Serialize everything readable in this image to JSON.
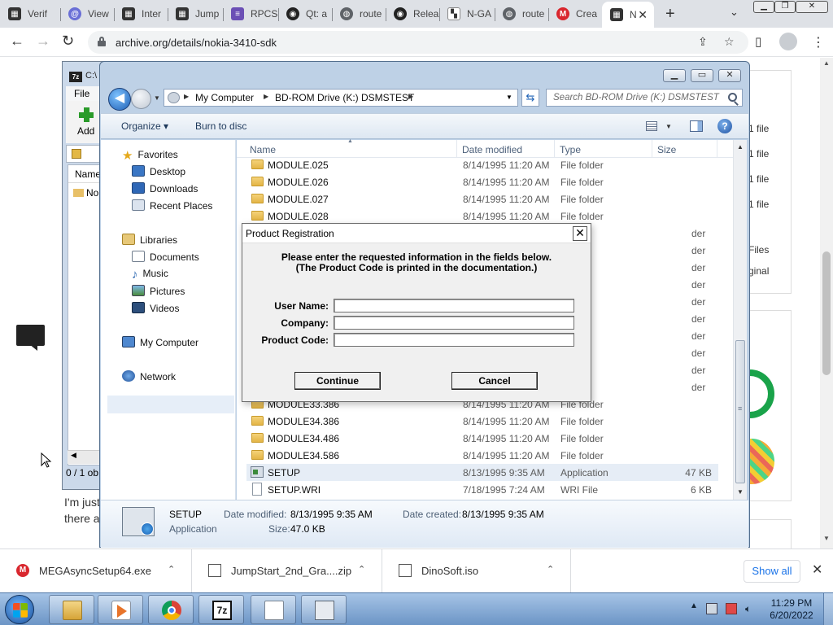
{
  "browser": {
    "tabs": [
      {
        "label": "Verif",
        "icon": "tab-page-icon"
      },
      {
        "label": "View",
        "icon": "tab-at-icon"
      },
      {
        "label": "Inter",
        "icon": "tab-page-icon"
      },
      {
        "label": "Jump",
        "icon": "tab-page-icon"
      },
      {
        "label": "RPCS",
        "icon": "tab-rpcs-icon"
      },
      {
        "label": "Qt: a",
        "icon": "github-icon"
      },
      {
        "label": "route",
        "icon": "globe-icon"
      },
      {
        "label": "Relea",
        "icon": "github-icon"
      },
      {
        "label": "N-GA",
        "icon": "grid-icon"
      },
      {
        "label": "route",
        "icon": "globe-icon"
      },
      {
        "label": "Crea",
        "icon": "mega-icon"
      },
      {
        "label": "N",
        "icon": "tab-page-icon"
      }
    ],
    "url": "archive.org/details/nokia-3410-sdk"
  },
  "page": {
    "side_panel_lines": [
      "1 file",
      "1 file",
      "1 file",
      "1 file",
      "Files",
      "ginal"
    ],
    "text_lines": [
      "I'm just",
      "there a"
    ]
  },
  "sevenzip": {
    "title": "C:\\",
    "menu_file": "File",
    "add_label": "Add",
    "col_name": "Name",
    "row": "No",
    "status": "0 / 1 ob"
  },
  "explorer": {
    "breadcrumb": [
      "My Computer",
      "BD-ROM Drive (K:) DSMSTEST"
    ],
    "search_placeholder": "Search BD-ROM Drive (K:) DSMSTEST",
    "commands": {
      "organize": "Organize",
      "burn": "Burn to disc"
    },
    "nav": {
      "favorites": "Favorites",
      "favorites_items": [
        "Desktop",
        "Downloads",
        "Recent Places"
      ],
      "libraries": "Libraries",
      "libraries_items": [
        "Documents",
        "Music",
        "Pictures",
        "Videos"
      ],
      "computer": "My Computer",
      "network": "Network"
    },
    "columns": {
      "name": "Name",
      "date": "Date modified",
      "type": "Type",
      "size": "Size"
    },
    "files_top": [
      {
        "name": "MODULE.025",
        "date": "8/14/1995 11:20 AM",
        "type": "File folder",
        "size": ""
      },
      {
        "name": "MODULE.026",
        "date": "8/14/1995 11:20 AM",
        "type": "File folder",
        "size": ""
      },
      {
        "name": "MODULE.027",
        "date": "8/14/1995 11:20 AM",
        "type": "File folder",
        "size": ""
      },
      {
        "name": "MODULE.028",
        "date": "8/14/1995 11:20 AM",
        "type": "File folder",
        "size": ""
      }
    ],
    "hidden_rows_text": [
      "der",
      "der",
      "der",
      "der",
      "der",
      "der",
      "der",
      "der",
      "der",
      "der"
    ],
    "files_bottom": [
      {
        "name": "MODULE33.386",
        "date": "8/14/1995 11:20 AM",
        "type": "File folder",
        "size": ""
      },
      {
        "name": "MODULE34.386",
        "date": "8/14/1995 11:20 AM",
        "type": "File folder",
        "size": ""
      },
      {
        "name": "MODULE34.486",
        "date": "8/14/1995 11:20 AM",
        "type": "File folder",
        "size": ""
      },
      {
        "name": "MODULE34.586",
        "date": "8/14/1995 11:20 AM",
        "type": "File folder",
        "size": ""
      },
      {
        "name": "SETUP",
        "date": "8/13/1995 9:35 AM",
        "type": "Application",
        "size": "47 KB"
      },
      {
        "name": "SETUP.WRI",
        "date": "7/18/1995 7:24 AM",
        "type": "WRI File",
        "size": "6 KB"
      }
    ],
    "details": {
      "name": "SETUP",
      "kind": "Application",
      "modified_label": "Date modified:",
      "modified": "8/13/1995 9:35 AM",
      "created_label": "Date created:",
      "created": "8/13/1995 9:35 AM",
      "size_label": "Size:",
      "size": "47.0 KB"
    }
  },
  "dialog": {
    "title": "Product Registration",
    "line1": "Please enter the requested information in the fields below.",
    "line2": "(The Product Code is printed in the documentation.)",
    "user_label": "User Name:",
    "company_label": "Company:",
    "code_label": "Product Code:",
    "user_value": "",
    "company_value": "",
    "code_value": "",
    "continue_label": "Continue",
    "cancel_label": "Cancel"
  },
  "downloads": {
    "items": [
      "MEGAsyncSetup64.exe",
      "JumpStart_2nd_Gra....zip",
      "DinoSoft.iso"
    ],
    "show_all": "Show all"
  },
  "taskbar": {
    "time": "11:29 PM",
    "date": "6/20/2022"
  },
  "colors": {
    "accent_blue": "#1a73e8",
    "mega_red": "#d9272e",
    "folder_yellow": "#e3b446"
  }
}
